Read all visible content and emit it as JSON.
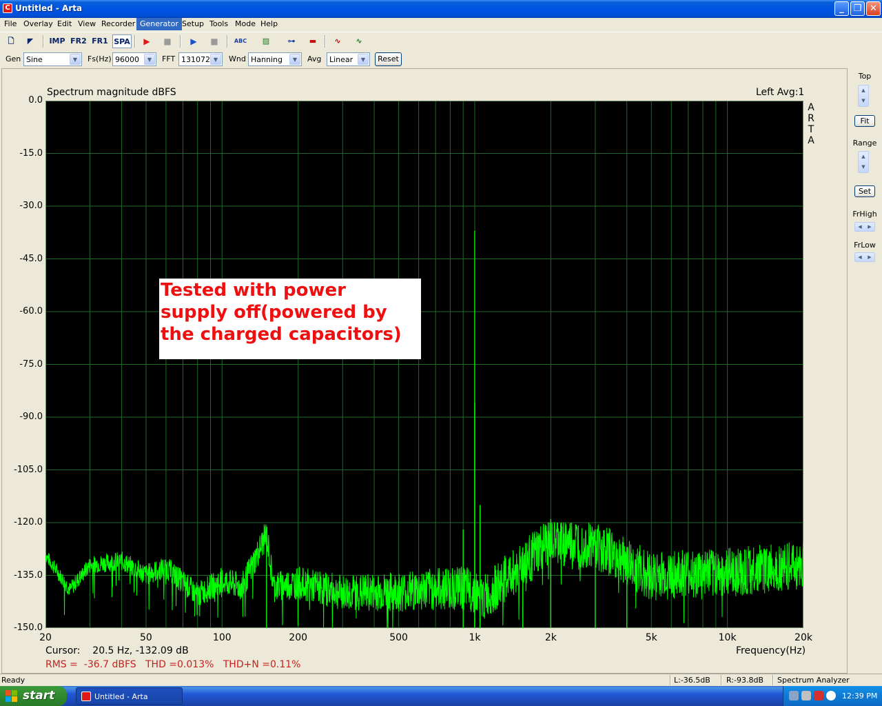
{
  "window": {
    "title": "Untitled - Arta",
    "icon": "arta-icon",
    "controls": [
      "minimize",
      "restore",
      "close"
    ]
  },
  "menu": [
    "File",
    "Overlay",
    "Edit",
    "View",
    "Recorder",
    "Generator",
    "Setup",
    "Tools",
    "Mode",
    "Help"
  ],
  "menu_active": "Generator",
  "toolbar": {
    "buttons": [
      {
        "name": "new-file-icon",
        "label": ""
      },
      {
        "name": "open-file-icon",
        "label": ""
      },
      {
        "name": "imp-mode-button",
        "label": "IMP"
      },
      {
        "name": "fr2-mode-button",
        "label": "FR2"
      },
      {
        "name": "fr1-mode-button",
        "label": "FR1"
      },
      {
        "name": "spa-mode-button",
        "label": "SPA"
      },
      {
        "name": "record-icon",
        "label": ""
      },
      {
        "name": "stop-icon",
        "label": ""
      },
      {
        "name": "play-icon",
        "label": ""
      },
      {
        "name": "stop-play-icon",
        "label": ""
      },
      {
        "name": "abc-icon",
        "label": "ABC"
      },
      {
        "name": "grid-icon",
        "label": ""
      },
      {
        "name": "slider-icon",
        "label": ""
      },
      {
        "name": "colors-icon",
        "label": ""
      },
      {
        "name": "sine-icon",
        "label": ""
      },
      {
        "name": "scope-icon",
        "label": ""
      }
    ]
  },
  "generator_row": {
    "gen_label": "Gen",
    "gen_value": "Sine",
    "fs_label": "Fs(Hz)",
    "fs_value": "96000",
    "fft_label": "FFT",
    "fft_value": "131072",
    "wnd_label": "Wnd",
    "wnd_value": "Hanning",
    "avg_label": "Avg",
    "avg_value": "Linear",
    "reset_label": "Reset"
  },
  "plot": {
    "title": "Spectrum magnitude dBFS",
    "right_title": "Left  Avg:1",
    "brand_letters": [
      "A",
      "R",
      "T",
      "A"
    ],
    "y_labels": [
      "0.0",
      "-15.0",
      "-30.0",
      "-45.0",
      "-60.0",
      "-75.0",
      "-90.0",
      "-105.0",
      "-120.0",
      "-135.0",
      "-150.0"
    ],
    "x_labels": [
      "20",
      "50",
      "100",
      "200",
      "500",
      "1k",
      "2k",
      "5k",
      "10k",
      "20k"
    ],
    "x_axis_label": "Frequency(Hz)",
    "cursor": "Cursor:    20.5 Hz, -132.09 dB",
    "stats": "RMS =  -36.7 dBFS   THD =0.013%   THD+N =0.11%",
    "annotation": "Tested with power supply off(powered by the charged capacitors)",
    "colors": {
      "background": "#000000",
      "grid": "#1f6b2a",
      "trace": "#00ff00",
      "annotation_text": "#ee1010",
      "stats_text": "#c82020"
    }
  },
  "chart_data": {
    "type": "line",
    "title": "Spectrum magnitude dBFS",
    "xlabel": "Frequency(Hz)",
    "ylabel": "",
    "x_scale": "log",
    "xlim": [
      20,
      20000
    ],
    "ylim": [
      -150,
      0
    ],
    "grid": true,
    "series": [
      {
        "name": "Left",
        "x": [
          20,
          25,
          30,
          40,
          50,
          60,
          80,
          100,
          120,
          150,
          160,
          200,
          300,
          500,
          800,
          1000,
          1050,
          2000,
          3000,
          5000,
          10000,
          20000
        ],
        "y": [
          -130,
          -140,
          -133,
          -132,
          -136,
          -134,
          -142,
          -138,
          -140,
          -125,
          -140,
          -139,
          -142,
          -142,
          -141,
          -37,
          -145,
          -128,
          -129,
          -138,
          -137,
          -135
        ]
      }
    ],
    "peaks": [
      {
        "x": 1000,
        "y": -37
      },
      {
        "x": 1000,
        "y": -86
      },
      {
        "x": 1050,
        "y": -115
      },
      {
        "x": 900,
        "y": -122
      },
      {
        "x": 2000,
        "y": -119
      },
      {
        "x": 1550,
        "y": -127
      },
      {
        "x": 3000,
        "y": -122
      },
      {
        "x": 150,
        "y": -124
      },
      {
        "x": 4000,
        "y": -127
      }
    ]
  },
  "right_panel": {
    "top_label": "Top",
    "fit_label": "Fit",
    "range_label": "Range",
    "set_label": "Set",
    "frhigh_label": "FrHigh",
    "frlow_label": "FrLow"
  },
  "status": {
    "left": "Ready",
    "l_level": "L:-36.5dB",
    "r_level": "R:-93.8dB",
    "mode": "Spectrum Analyzer"
  },
  "taskbar": {
    "start_label": "start",
    "task_label": "Untitled - Arta",
    "clock": "12:39 PM"
  }
}
